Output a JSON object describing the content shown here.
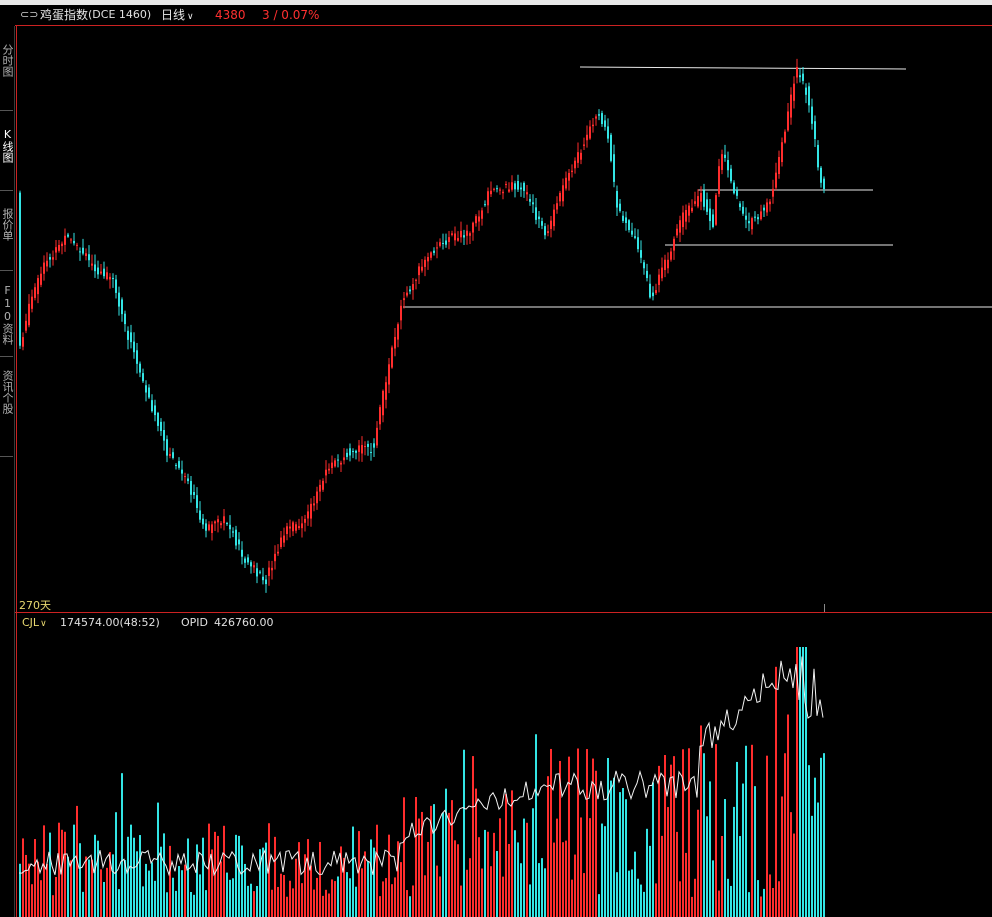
{
  "header": {
    "icon": "link-icon",
    "instrument": "鸡蛋指数",
    "code": "(DCE 1460)",
    "period": "日线",
    "price": "4380",
    "change": "3 / 0.07%"
  },
  "side_tabs": [
    "分时图",
    "K线图",
    "报价单",
    "F10资料",
    "资讯个股"
  ],
  "active_tab": 1,
  "main_chart": {
    "days_label": "270天"
  },
  "volume_panel": {
    "indicator": "CJL",
    "volume": "174574.00(48:52)",
    "opid_label": "OPID",
    "opid": "426760.00"
  },
  "colors": {
    "background": "#000000",
    "up": "#ff2d2d",
    "down": "#33e5e5",
    "border": "#cc2222",
    "label": "#c8c8c8",
    "price_red": "#ff3030",
    "days_label": "#e8d870"
  }
}
